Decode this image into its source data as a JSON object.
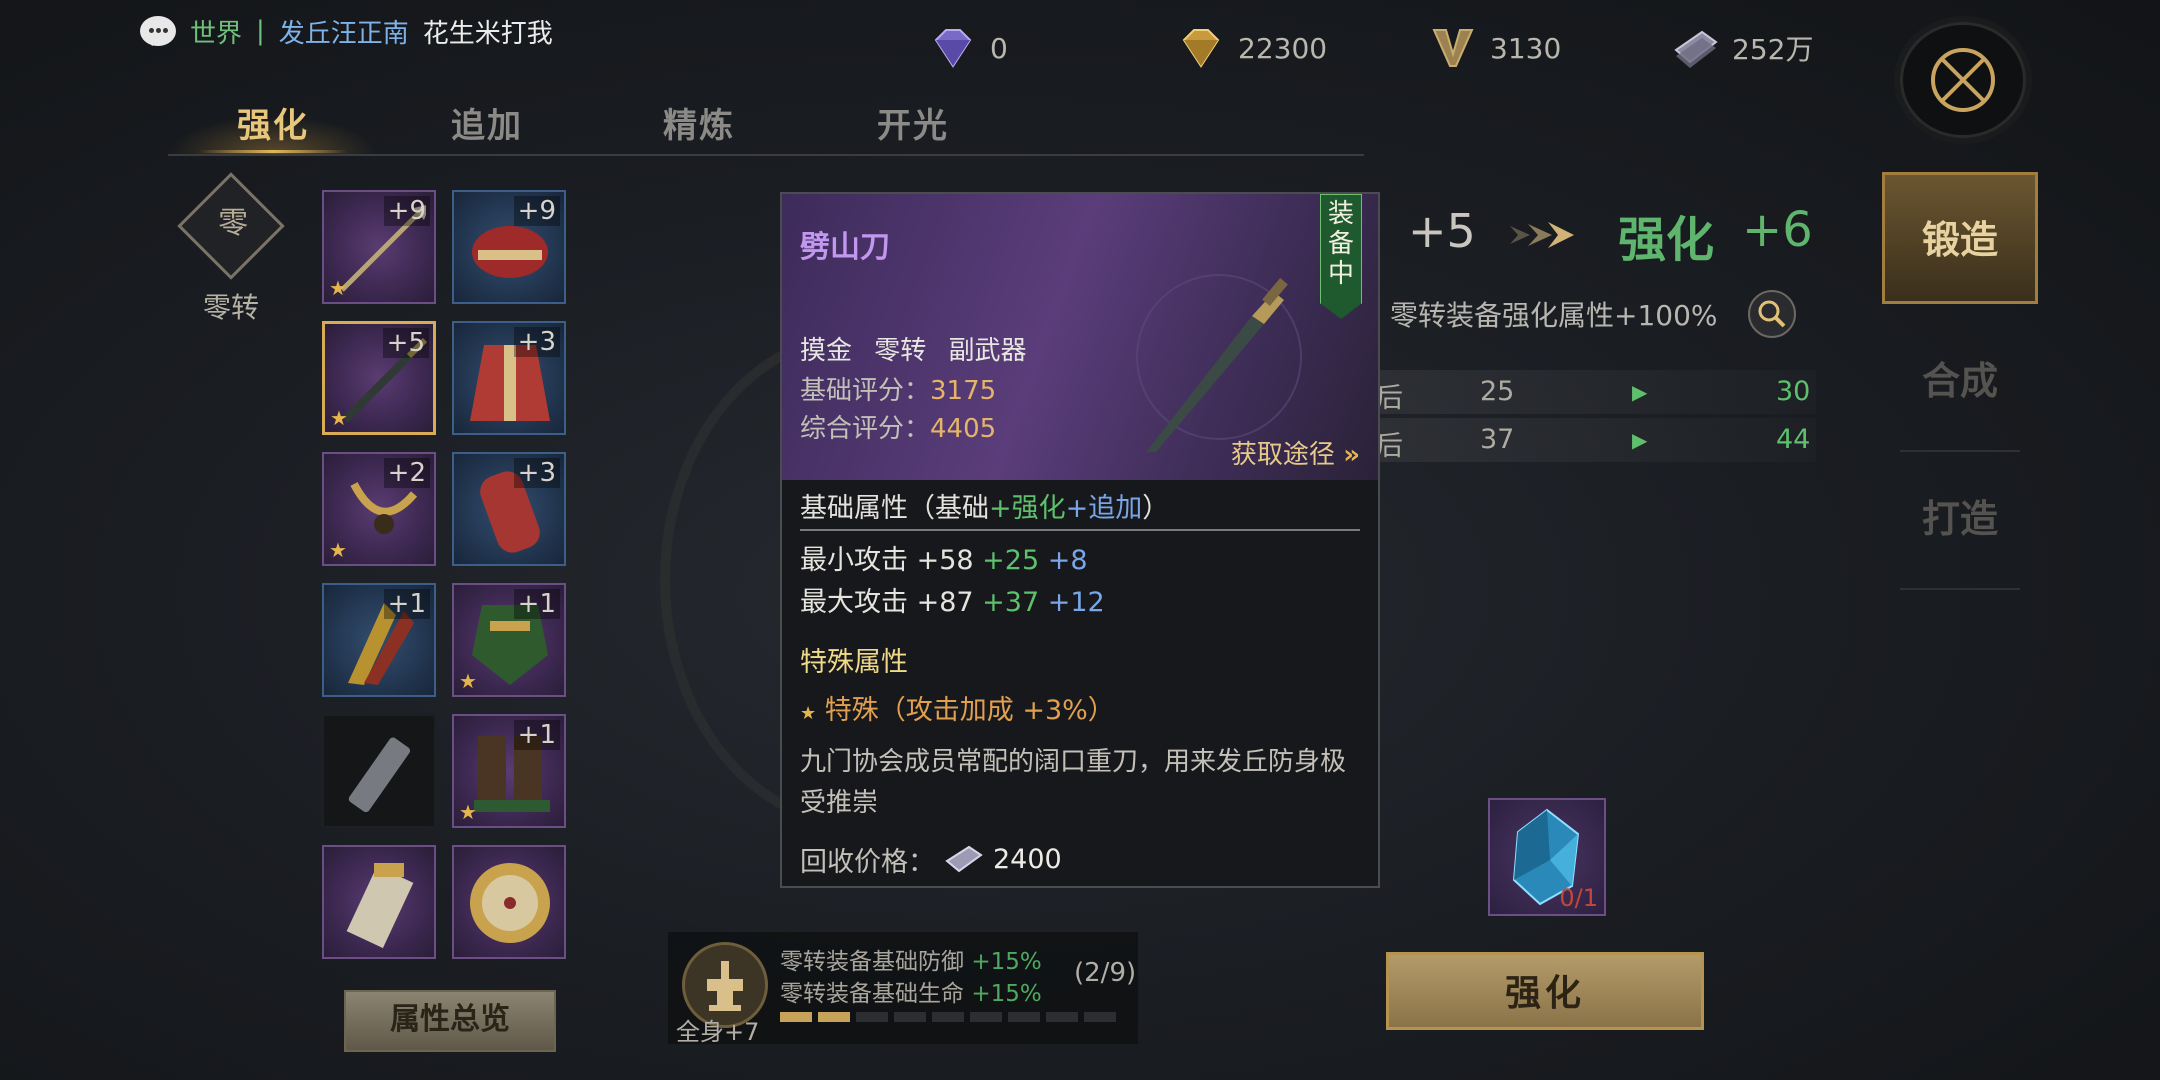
{
  "chat": {
    "channel": "世界",
    "separator": "|",
    "sender": "发丘汪正南",
    "message": "花生米打我"
  },
  "resources": [
    {
      "name": "purple-diamond-icon",
      "value": "0"
    },
    {
      "name": "gold-diamond-icon",
      "value": "22300"
    },
    {
      "name": "v-coin-icon",
      "value": "3130"
    },
    {
      "name": "silver-ticket-icon",
      "value": "252万"
    }
  ],
  "tabs": [
    "强化",
    "追加",
    "精炼",
    "开光"
  ],
  "active_tab": "强化",
  "left": {
    "zero_turn_emblem": "零",
    "zero_turn_label": "零转"
  },
  "slots": [
    {
      "level": "+9",
      "quality": "purple",
      "star": true,
      "icon": "spear-icon"
    },
    {
      "level": "+9",
      "quality": "blue",
      "star": false,
      "icon": "hat-icon"
    },
    {
      "level": "+5",
      "quality": "purple",
      "star": true,
      "icon": "blade-icon",
      "selected": true
    },
    {
      "level": "+3",
      "quality": "blue",
      "star": false,
      "icon": "robe-icon"
    },
    {
      "level": "+2",
      "quality": "purple",
      "star": true,
      "icon": "belt-icon"
    },
    {
      "level": "+3",
      "quality": "blue",
      "star": false,
      "icon": "bracer-icon"
    },
    {
      "level": "+1",
      "quality": "blue",
      "star": false,
      "icon": "claw-icon"
    },
    {
      "level": "+1",
      "quality": "purple",
      "star": true,
      "icon": "armor-icon"
    },
    {
      "level": "",
      "quality": "empty",
      "star": false,
      "icon": "talisman-icon"
    },
    {
      "level": "+1",
      "quality": "purple",
      "star": true,
      "icon": "boots-icon"
    },
    {
      "level": "",
      "quality": "purple",
      "star": false,
      "icon": "scroll-icon"
    },
    {
      "level": "",
      "quality": "purple",
      "star": false,
      "icon": "compass-icon"
    }
  ],
  "attr_overview_label": "属性总览",
  "enhance": {
    "current": "+5",
    "label": "强化",
    "next": "+6",
    "bonus_text": "零转装备强化属性+100%",
    "rows": [
      {
        "label": "后",
        "from": "25",
        "to": "30"
      },
      {
        "label": "后",
        "from": "37",
        "to": "44"
      }
    ],
    "material_count": "0/1",
    "button_label": "强化"
  },
  "nav": {
    "forge": "锻造",
    "synth": "合成",
    "craft": "打造"
  },
  "full_set": {
    "label": "全身+7",
    "line1_label": "零转装备基础防御",
    "line1_value": "+15%",
    "line2_label": "零转装备基础生命",
    "line2_value": "+15%",
    "progress": "(2/9)",
    "filled": 2,
    "total": 9
  },
  "popup": {
    "name": "劈山刀",
    "equipped_tag": "装备中",
    "tags": "摸金 零转 副武器",
    "base_score_label": "基础评分：",
    "base_score": "3175",
    "total_score_label": "综合评分：",
    "total_score": "4405",
    "obtain": "获取途径",
    "base_attr_prefix": "基础属性（基础",
    "base_attr_plus_enh": "+强化",
    "base_attr_plus_add": "+追加",
    "base_attr_suffix": "）",
    "min_atk_label": "最小攻击 +58",
    "min_atk_enh": "+25",
    "min_atk_add": "+8",
    "max_atk_label": "最大攻击 +87",
    "max_atk_enh": "+37",
    "max_atk_add": "+12",
    "special_title": "特殊属性",
    "special_value": "特殊（攻击加成 +3%）",
    "description": "九门协会成员常配的阔口重刀，用来发丘防身极受推崇",
    "price_label": "回收价格：",
    "price_value": "2400"
  },
  "colors": {
    "gold_accent": "#e9c77a",
    "green_stat": "#5ec06d",
    "blue_stat": "#79a6e8",
    "purple_name": "#c197ef"
  }
}
